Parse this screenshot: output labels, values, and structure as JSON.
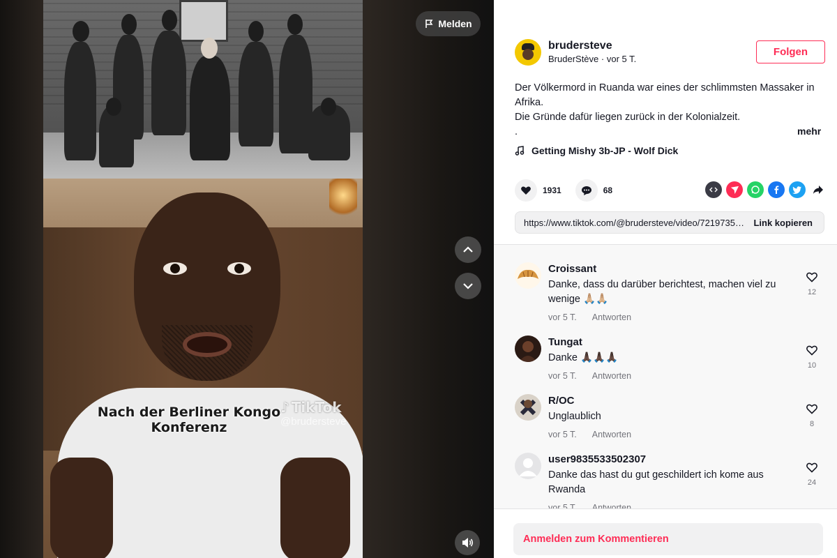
{
  "video": {
    "report_label": "Melden",
    "caption_line1": "Nach der Berliner Kongo",
    "caption_line2": "Konferenz",
    "watermark_logo": "TikTok",
    "watermark_handle": "@brudersteve"
  },
  "author": {
    "username": "brudersteve",
    "display_name": "BruderStève",
    "time": "vor 5 T.",
    "follow_label": "Folgen"
  },
  "description": {
    "line1": "Der Völkermord in Ruanda war eines der schlimmsten Massaker in Afrika.",
    "line2": "Die Gründe dafür liegen zurück in der Kolonialzeit.",
    "line3": ".",
    "more_label": "mehr"
  },
  "music": {
    "title": "Getting Mishy 3b-JP - Wolf Dick"
  },
  "stats": {
    "likes": "1931",
    "comments": "68"
  },
  "share_icons": [
    "embed-icon",
    "send-icon",
    "whatsapp-icon",
    "facebook-icon",
    "twitter-icon",
    "share-arrow-icon"
  ],
  "link": {
    "url": "https://www.tiktok.com/@brudersteve/video/72197355...",
    "copy_label": "Link kopieren"
  },
  "comments": [
    {
      "name": "Croissant",
      "text": "Danke, dass du darüber berichtest, machen viel zu wenige 🙏🏼🙏🏼",
      "time": "vor 5 T.",
      "reply": "Antworten",
      "likes": "12"
    },
    {
      "name": "Tungat",
      "text": "Danke 🙏🏿🙏🏿🙏🏿",
      "time": "vor 5 T.",
      "reply": "Antworten",
      "likes": "10"
    },
    {
      "name": "R/OC",
      "text": "Unglaublich",
      "time": "vor 5 T.",
      "reply": "Antworten",
      "likes": "8"
    },
    {
      "name": "user9835533502307",
      "text": "Danke das hast du gut geschildert ich kome aus Rwanda",
      "time": "vor 5 T.",
      "reply": "Antworten",
      "likes": "24"
    }
  ],
  "login_prompt": "Anmelden zum Kommentieren",
  "colors": {
    "accent": "#fe2c55",
    "text": "#161823",
    "comment_bg": "#f8f8f8"
  }
}
